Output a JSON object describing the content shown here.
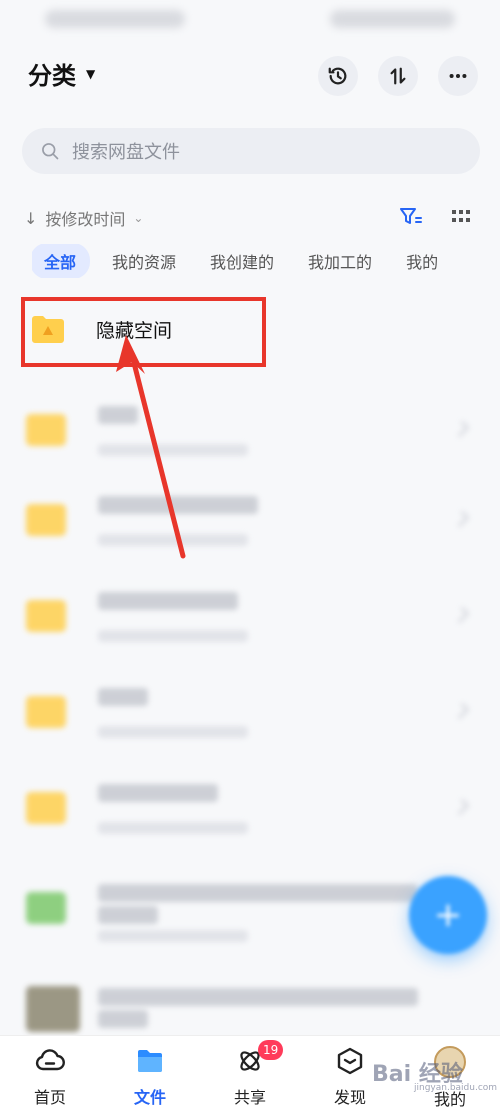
{
  "header": {
    "title": "分类",
    "title_caret": "▼"
  },
  "actions": {
    "history_icon": "history-icon",
    "transfer_icon": "transfer-icon",
    "more_icon": "more-icon"
  },
  "search": {
    "placeholder": "搜索网盘文件"
  },
  "sort": {
    "arrow": "↓",
    "label": "按修改时间",
    "chevron": "⌄"
  },
  "tabs": [
    "全部",
    "我的资源",
    "我创建的",
    "我加工的",
    "我的"
  ],
  "highlighted_item": {
    "name": "隐藏空间"
  },
  "colors": {
    "accent": "#2765f5",
    "highlight": "#e8362b",
    "folder": "#ffcf4d",
    "badge": "#ff3b5a",
    "fab": "#3aa2ff"
  },
  "fab": {
    "label": "+"
  },
  "bottom_nav": {
    "items": [
      {
        "label": "首页",
        "icon": "cloud-home-icon"
      },
      {
        "label": "文件",
        "icon": "folder-icon"
      },
      {
        "label": "共享",
        "icon": "share-atom-icon",
        "badge": "19"
      },
      {
        "label": "发现",
        "icon": "discover-cube-icon"
      },
      {
        "label": "我的",
        "icon": "avatar"
      }
    ]
  },
  "watermark": {
    "text": "Bai 经验",
    "sub": "jingyan.baidu.com"
  }
}
